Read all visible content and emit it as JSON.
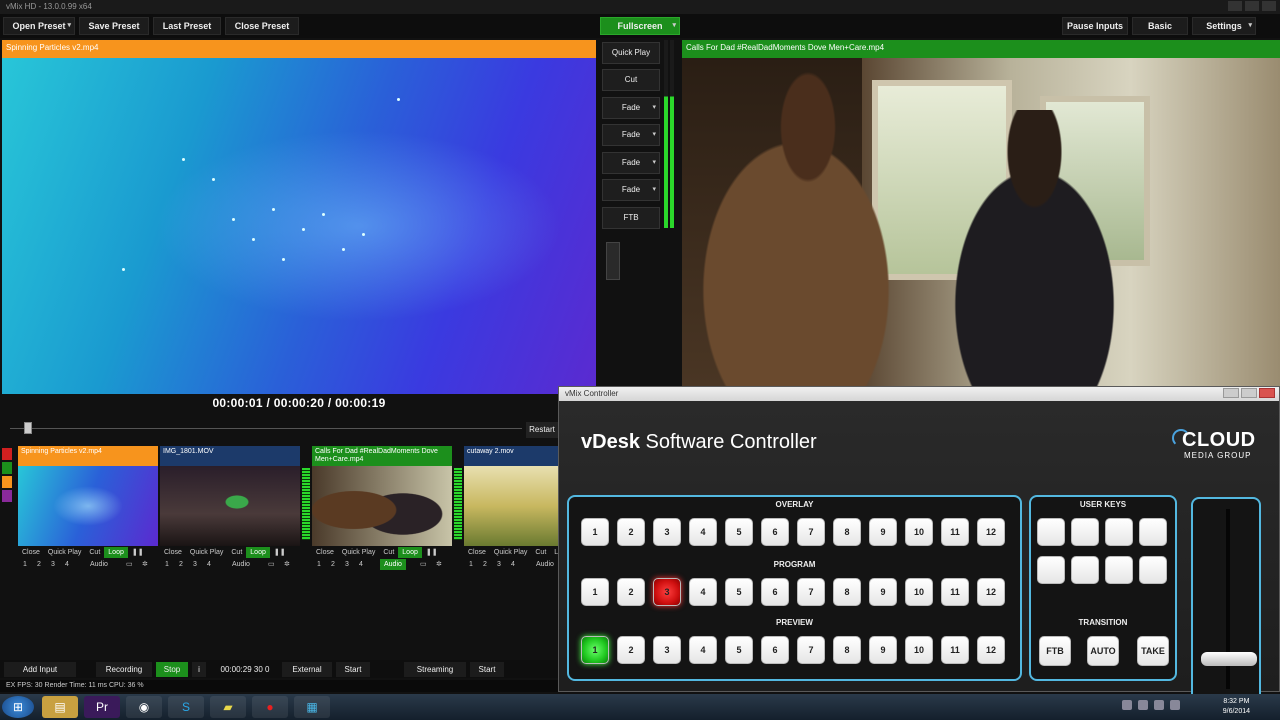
{
  "window": {
    "title": "vMix HD - 13.0.0.99 x64"
  },
  "toolbar": {
    "open_preset": "Open Preset",
    "save_preset": "Save Preset",
    "last_preset": "Last Preset",
    "close_preset": "Close Preset",
    "fullscreen": "Fullscreen",
    "pause_inputs": "Pause Inputs",
    "basic": "Basic",
    "settings": "Settings"
  },
  "preview": {
    "title": "Spinning Particles v2.mp4",
    "timecode": "00:00:01  /  00:00:20  /  00:00:19",
    "restart": "Restart"
  },
  "program": {
    "title": "Calls For Dad  #RealDadMoments  Dove Men+Care.mp4"
  },
  "transitions": [
    "Quick Play",
    "Cut",
    "Fade",
    "Fade",
    "Fade",
    "Fade",
    "FTB"
  ],
  "inputs": [
    {
      "title": "Spinning Particles v2.mp4",
      "color": "#f7941d",
      "thumb": "particles",
      "controls": [
        "Close",
        "Quick Play",
        "Cut",
        "Loop"
      ],
      "nums": [
        "1",
        "2",
        "3",
        "4"
      ],
      "audio": "Audio",
      "loop_on": true,
      "audio_on": false
    },
    {
      "title": "IMG_1801.MOV",
      "color": "#1c3a6a",
      "thumb": "room",
      "controls": [
        "Close",
        "Quick Play",
        "Cut",
        "Loop"
      ],
      "nums": [
        "1",
        "2",
        "3",
        "4"
      ],
      "audio": "Audio",
      "loop_on": true,
      "audio_on": false
    },
    {
      "title": "Calls For Dad  #RealDadMoments  Dove Men+Care.mp4",
      "color": "#1c8f1c",
      "thumb": "dad",
      "controls": [
        "Close",
        "Quick Play",
        "Cut",
        "Loop"
      ],
      "nums": [
        "1",
        "2",
        "3",
        "4"
      ],
      "audio": "Audio",
      "loop_on": true,
      "audio_on": true
    },
    {
      "title": "cutaway 2.mov",
      "color": "#1c3a6a",
      "thumb": "outdoor",
      "controls": [
        "Close",
        "Quick Play",
        "Cut",
        "Loop"
      ],
      "nums": [
        "1",
        "2",
        "3",
        "4"
      ],
      "audio": "Audio",
      "loop_on": false,
      "audio_on": false
    }
  ],
  "bottombar": {
    "add_input": "Add Input",
    "recording": "Recording",
    "stop": "Stop",
    "info": "i",
    "rec_time": "00:00:29 30 0",
    "external": "External",
    "start1": "Start",
    "streaming": "Streaming",
    "start2": "Start"
  },
  "status": {
    "text": "EX  FPS: 30  Render Time: 11 ms  CPU: 36 %"
  },
  "controller": {
    "window_title": "vMix Controller",
    "brand_bold": "vDesk",
    "brand_rest": " Software Controller",
    "logo_top": "CLOUD",
    "logo_bottom": "MEDIA GROUP",
    "overlay_label": "OVERLAY",
    "program_label": "PROGRAM",
    "preview_label": "PREVIEW",
    "user_keys_label": "USER KEYS",
    "transition_label": "TRANSITION",
    "keys": [
      "1",
      "2",
      "3",
      "4",
      "5",
      "6",
      "7",
      "8",
      "9",
      "10",
      "11",
      "12"
    ],
    "program_active": "3",
    "preview_active": "1",
    "ftb": "FTB",
    "auto": "AUTO",
    "take": "TAKE",
    "fader_level": 0.12
  },
  "taskbar": {
    "time": "8:32 PM",
    "date": "9/6/2014"
  },
  "colors": {
    "preview_header": "#f7941d",
    "program_header": "#1c8f1c",
    "panel_border": "#53b8e0"
  }
}
